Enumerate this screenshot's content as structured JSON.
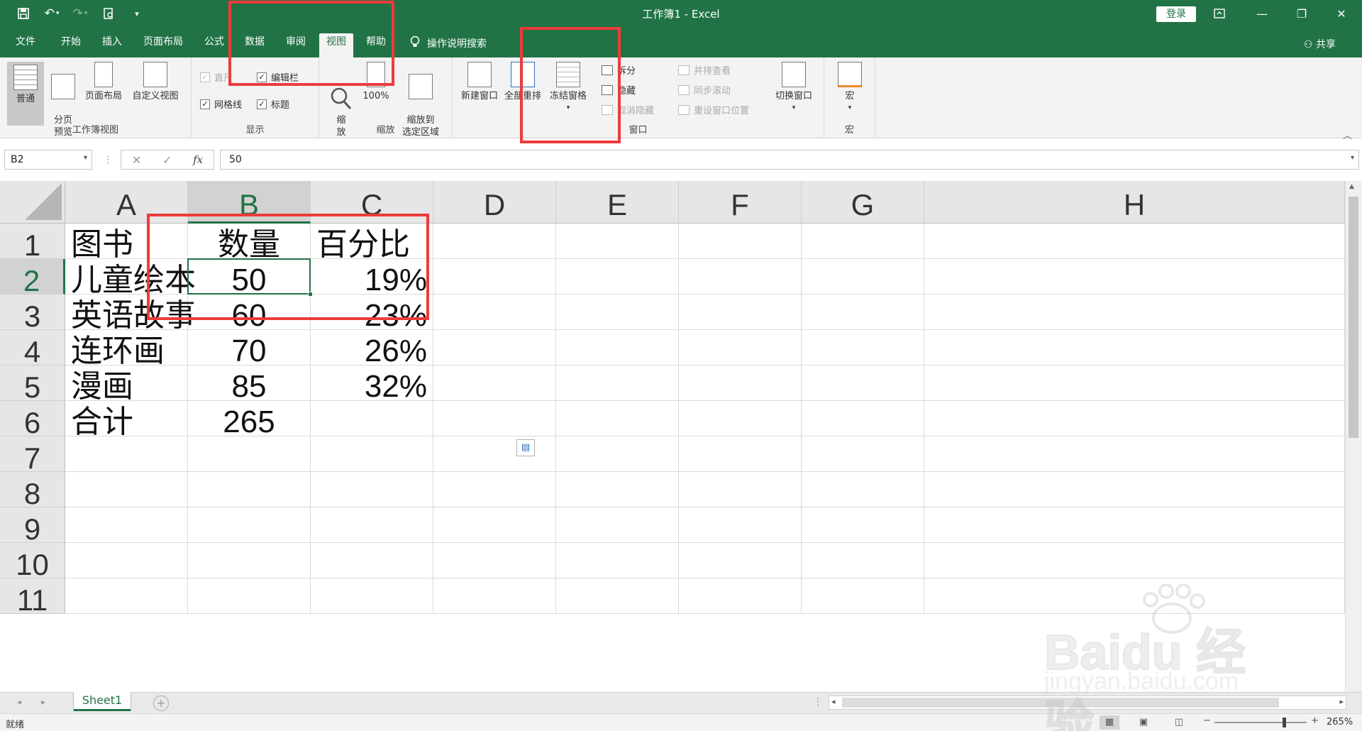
{
  "window": {
    "title": "工作簿1  -  Excel",
    "signin": "登录",
    "share": "共享"
  },
  "tabs": [
    "文件",
    "开始",
    "插入",
    "页面布局",
    "公式",
    "数据",
    "审阅",
    "视图",
    "帮助"
  ],
  "active_tab": "视图",
  "tellme": "操作说明搜索",
  "ribbon": {
    "workbook_views": {
      "label": "工作簿视图",
      "normal": "普通",
      "pagebreak": "分页\n预览",
      "pagelayout": "页面布局",
      "custom": "自定义视图"
    },
    "show": {
      "label": "显示",
      "ruler": "直尺",
      "formula_bar": "编辑栏",
      "gridlines": "网格线",
      "headings": "标题"
    },
    "zoom": {
      "label": "缩放",
      "zoom": "缩\n放",
      "hundred": "100%",
      "to_selection": "缩放到\n选定区域"
    },
    "window": {
      "label": "窗口",
      "new_window": "新建窗口",
      "arrange_all": "全部重排",
      "freeze_panes": "冻结窗格",
      "split": "拆分",
      "hide": "隐藏",
      "unhide": "取消隐藏",
      "side_by_side": "并排查看",
      "sync_scroll": "同步滚动",
      "reset_position": "重设窗口位置",
      "switch_windows": "切换窗口"
    },
    "macros": {
      "label": "宏",
      "macros": "宏"
    }
  },
  "formula_bar": {
    "name_box": "B2",
    "value": "50",
    "fx": "fx"
  },
  "columns": [
    "A",
    "B",
    "C",
    "D",
    "E",
    "F",
    "G",
    "H"
  ],
  "rows": [
    "1",
    "2",
    "3",
    "4",
    "5",
    "6",
    "7",
    "8",
    "9",
    "10",
    "11"
  ],
  "cells": {
    "A1": "图书",
    "B1": "数量",
    "C1": "百分比",
    "A2": "儿童绘本",
    "B2": "50",
    "C2": "19%",
    "A3": "英语故事",
    "B3": "60",
    "C3": "23%",
    "A4": "连环画",
    "B4": "70",
    "C4": "26%",
    "A5": "漫画",
    "B5": "85",
    "C5": "32%",
    "A6": "合计",
    "B6": "265"
  },
  "sheet_tabs": [
    "Sheet1"
  ],
  "status": {
    "ready": "就绪",
    "zoom": "265%"
  },
  "watermark": {
    "brand": "Baidu 经验",
    "url": "jingyan.baidu.com"
  }
}
